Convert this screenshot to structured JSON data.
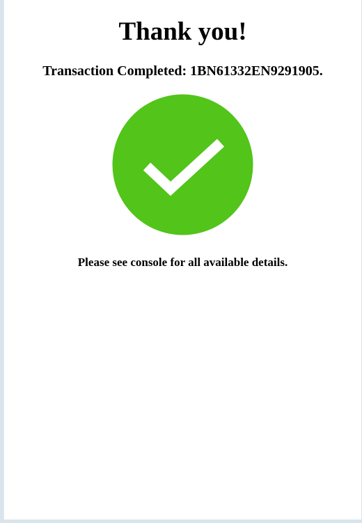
{
  "page": {
    "title": "Thank you!",
    "transaction_label": "Transaction Completed: 1BN61332EN9291905.",
    "note": "Please see console for all available details."
  },
  "icon": {
    "name": "checkmark-circle-icon",
    "circle_color": "#52c41a",
    "check_color": "#ffffff"
  }
}
